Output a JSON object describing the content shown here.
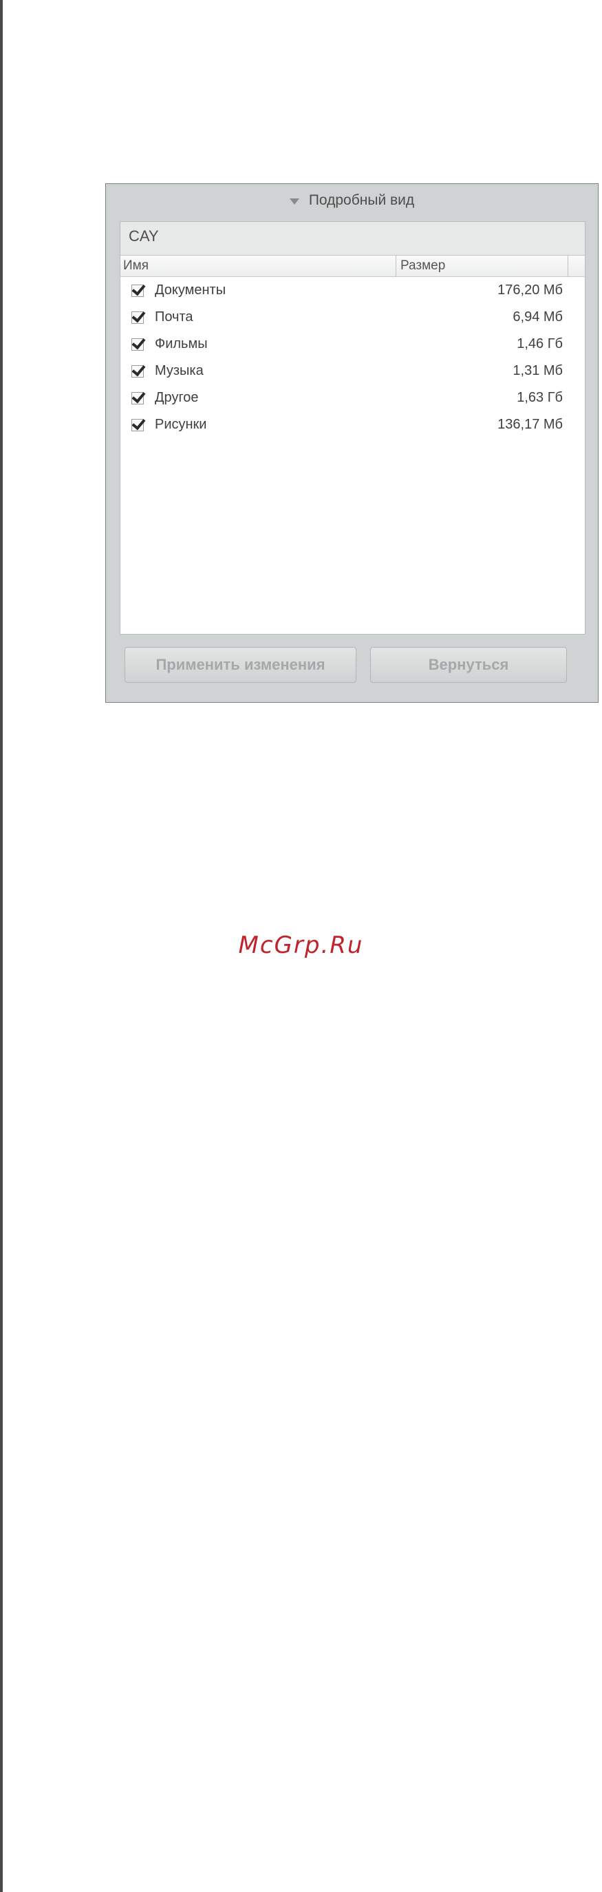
{
  "panel": {
    "header": "Подробный вид",
    "device": "CAY",
    "columns": {
      "name": "Имя",
      "size": "Размер"
    },
    "items": [
      {
        "name": "Документы",
        "size": "176,20 Мб",
        "checked": true
      },
      {
        "name": "Почта",
        "size": "6,94 Мб",
        "checked": true
      },
      {
        "name": "Фильмы",
        "size": "1,46 Гб",
        "checked": true
      },
      {
        "name": "Музыка",
        "size": "1,31 Мб",
        "checked": true
      },
      {
        "name": "Другое",
        "size": "1,63 Гб",
        "checked": true
      },
      {
        "name": "Рисунки",
        "size": "136,17 Мб",
        "checked": true
      }
    ],
    "buttons": {
      "apply": "Применить изменения",
      "back": "Вернуться"
    }
  },
  "watermark": "McGrp.Ru",
  "icons": {
    "expand": "triangle-down-icon",
    "check": "checkbox-checked-icon"
  },
  "colors": {
    "watermark": "#c0242b",
    "panel": "#d0d3d4"
  }
}
